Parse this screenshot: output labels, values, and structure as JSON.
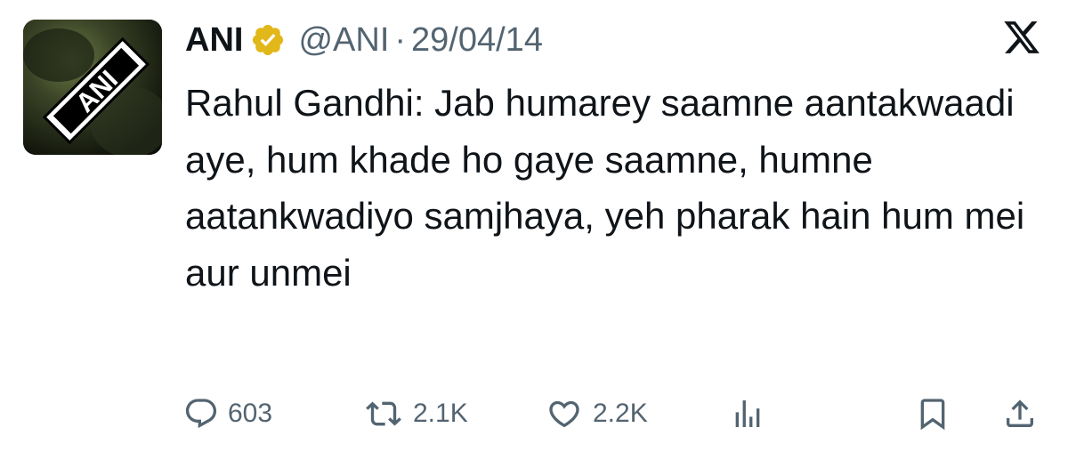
{
  "tweet": {
    "author_name": "ANI",
    "handle": "@ANI",
    "separator": "·",
    "date": "29/04/14",
    "avatar_text": "ANI",
    "text": "Rahul Gandhi: Jab humarey saamne aantakwaadi aye, hum khade ho gaye saamne, humne aatankwadiyo samjhaya, yeh pharak hain hum mei aur unmei",
    "verified_badge_color": "#e2b719"
  },
  "actions": {
    "replies": "603",
    "reposts": "2.1K",
    "likes": "2.2K"
  },
  "icons": {
    "reply": "reply-icon",
    "repost": "repost-icon",
    "like": "heart-icon",
    "views": "analytics-icon",
    "bookmark": "bookmark-icon",
    "share": "share-icon",
    "logo": "x-logo-icon"
  },
  "colors": {
    "text": "#0f1419",
    "secondary": "#536471"
  }
}
